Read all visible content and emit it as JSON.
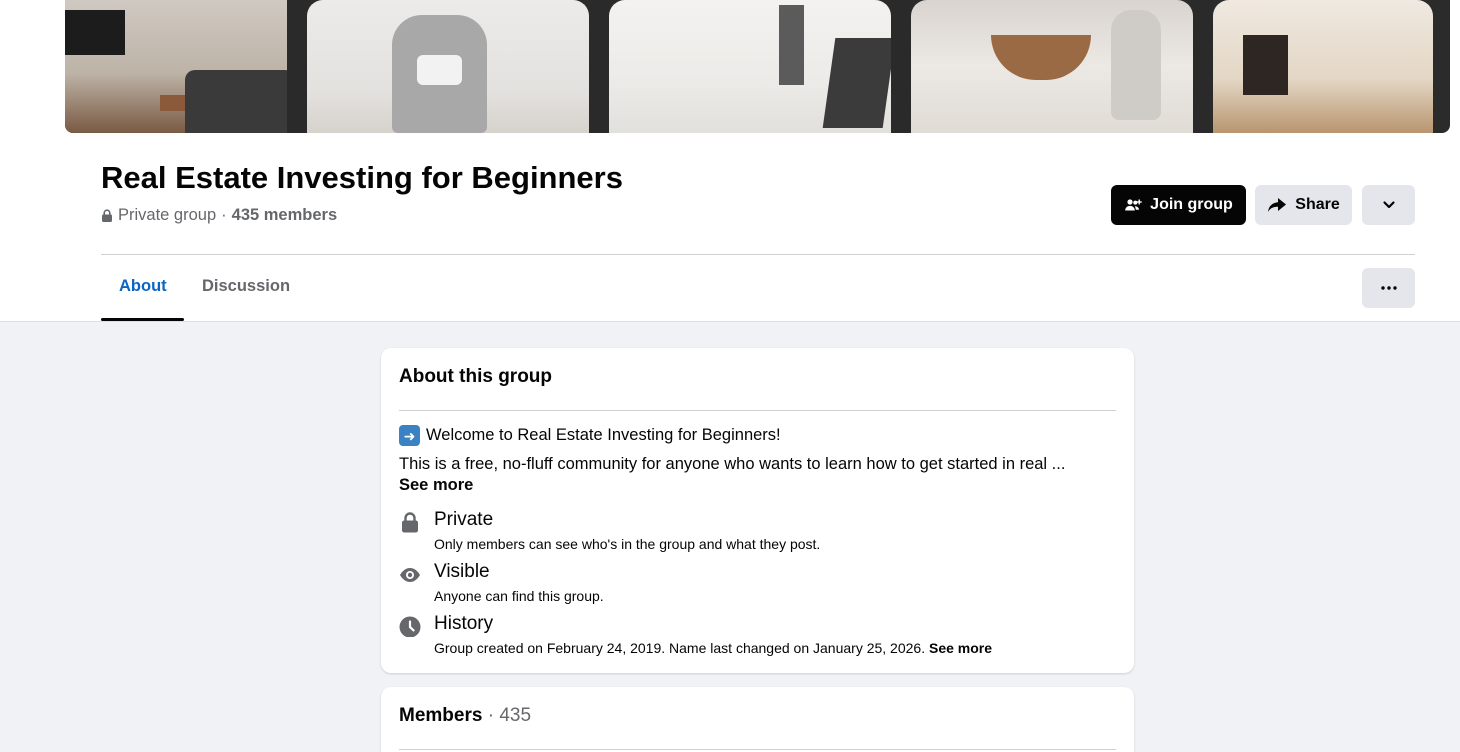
{
  "group": {
    "name": "Real Estate Investing for Beginners",
    "privacy": "Private group",
    "separator": "·",
    "members_text": "435 members"
  },
  "actions": {
    "join_label": "Join group",
    "share_label": "Share"
  },
  "tabs": [
    {
      "label": "About",
      "active": true
    },
    {
      "label": "Discussion",
      "active": false
    }
  ],
  "about_card": {
    "title": "About this group",
    "welcome": "Welcome to Real Estate Investing for Beginners!",
    "description": "This is a free, no-fluff community for anyone who wants to learn how to get started in real ...",
    "see_more": "See more",
    "items": [
      {
        "icon": "lock-icon",
        "title": "Private",
        "text": "Only members can see who's in the group and what they post."
      },
      {
        "icon": "eye-icon",
        "title": "Visible",
        "text": "Anyone can find this group."
      },
      {
        "icon": "clock-icon",
        "title": "History",
        "text": "Group created on February 24, 2019. Name last changed on January 25, 2026.",
        "see_more": "See more"
      }
    ]
  },
  "members_card": {
    "title": "Members",
    "separator": "·",
    "count": "435"
  },
  "colors": {
    "accent": "#0a66c2",
    "join_button": "#050505",
    "secondary_button": "#e4e6eb",
    "page_background": "#f0f2f5"
  }
}
